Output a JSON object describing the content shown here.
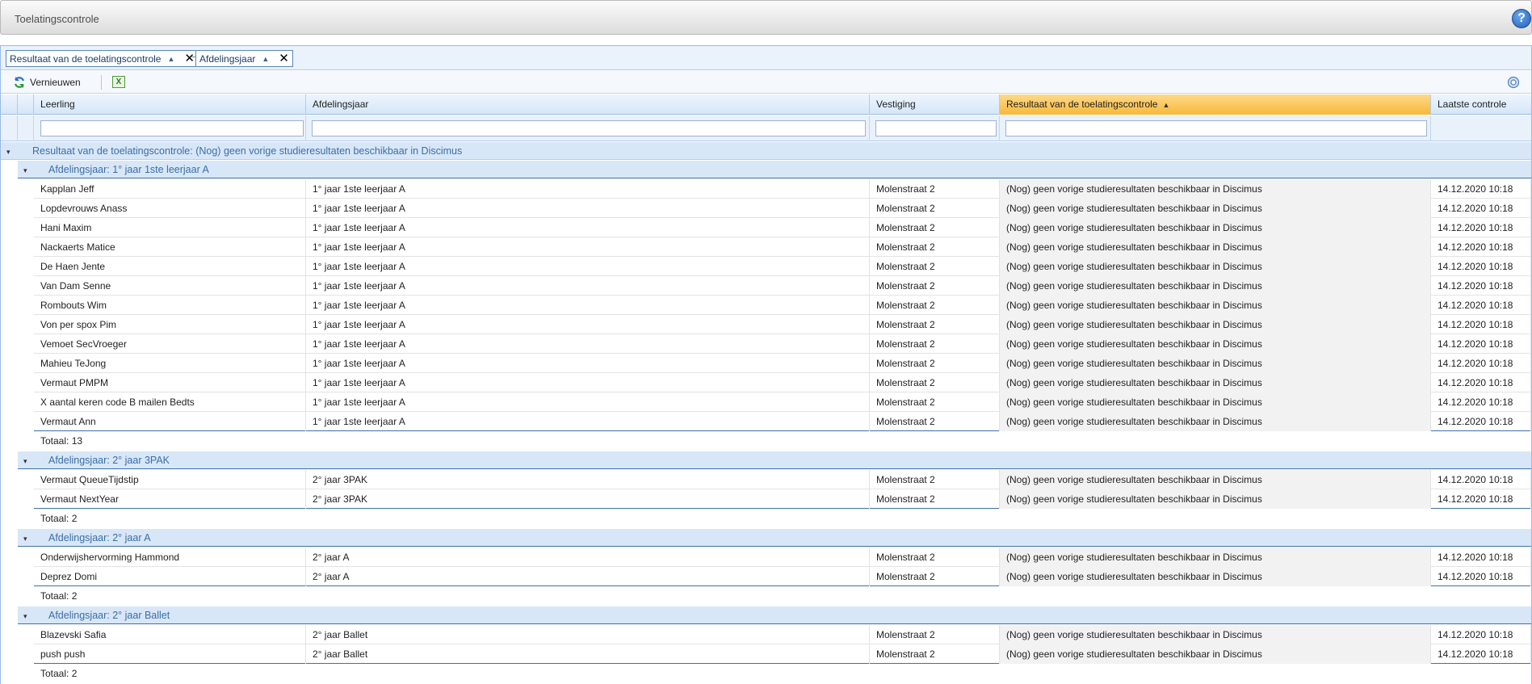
{
  "window": {
    "title": "Toelatingscontrole",
    "help": "?"
  },
  "groupbar": {
    "chips": [
      {
        "label": "Resultaat van de toelatingscontrole"
      },
      {
        "label": "Afdelingsjaar"
      }
    ]
  },
  "toolbar": {
    "refresh_label": "Vernieuwen",
    "excel_label": "X"
  },
  "columns": {
    "leerling": "Leerling",
    "afdelingsjaar": "Afdelingsjaar",
    "vestiging": "Vestiging",
    "resultaat": "Resultaat van de toelatingscontrole",
    "laatste": "Laatste controle"
  },
  "outer_group": {
    "label": "Resultaat van de toelatingscontrole: (Nog) geen vorige studieresultaten beschikbaar in Discimus"
  },
  "groups": [
    {
      "label": "Afdelingsjaar: 1° jaar 1ste leerjaar A",
      "total": "Totaal: 13",
      "rows": [
        {
          "leerling": "Kapplan Jeff",
          "afdelingsjaar": "1° jaar 1ste leerjaar A",
          "vestiging": "Molenstraat 2",
          "resultaat": "(Nog) geen vorige studieresultaten beschikbaar in Discimus",
          "laatste": "14.12.2020 10:18"
        },
        {
          "leerling": "Lopdevrouws Anass",
          "afdelingsjaar": "1° jaar 1ste leerjaar A",
          "vestiging": "Molenstraat 2",
          "resultaat": "(Nog) geen vorige studieresultaten beschikbaar in Discimus",
          "laatste": "14.12.2020 10:18"
        },
        {
          "leerling": "Hani Maxim",
          "afdelingsjaar": "1° jaar 1ste leerjaar A",
          "vestiging": "Molenstraat 2",
          "resultaat": "(Nog) geen vorige studieresultaten beschikbaar in Discimus",
          "laatste": "14.12.2020 10:18"
        },
        {
          "leerling": "Nackaerts Matice",
          "afdelingsjaar": "1° jaar 1ste leerjaar A",
          "vestiging": "Molenstraat 2",
          "resultaat": "(Nog) geen vorige studieresultaten beschikbaar in Discimus",
          "laatste": "14.12.2020 10:18"
        },
        {
          "leerling": "De Haen Jente",
          "afdelingsjaar": "1° jaar 1ste leerjaar A",
          "vestiging": "Molenstraat 2",
          "resultaat": "(Nog) geen vorige studieresultaten beschikbaar in Discimus",
          "laatste": "14.12.2020 10:18"
        },
        {
          "leerling": "Van Dam Senne",
          "afdelingsjaar": "1° jaar 1ste leerjaar A",
          "vestiging": "Molenstraat 2",
          "resultaat": "(Nog) geen vorige studieresultaten beschikbaar in Discimus",
          "laatste": "14.12.2020 10:18"
        },
        {
          "leerling": "Rombouts Wim",
          "afdelingsjaar": "1° jaar 1ste leerjaar A",
          "vestiging": "Molenstraat 2",
          "resultaat": "(Nog) geen vorige studieresultaten beschikbaar in Discimus",
          "laatste": "14.12.2020 10:18"
        },
        {
          "leerling": "Von per spox Pim",
          "afdelingsjaar": "1° jaar 1ste leerjaar A",
          "vestiging": "Molenstraat 2",
          "resultaat": "(Nog) geen vorige studieresultaten beschikbaar in Discimus",
          "laatste": "14.12.2020 10:18"
        },
        {
          "leerling": "Vemoet SecVroeger",
          "afdelingsjaar": "1° jaar 1ste leerjaar A",
          "vestiging": "Molenstraat 2",
          "resultaat": "(Nog) geen vorige studieresultaten beschikbaar in Discimus",
          "laatste": "14.12.2020 10:18"
        },
        {
          "leerling": "Mahieu TeJong",
          "afdelingsjaar": "1° jaar 1ste leerjaar A",
          "vestiging": "Molenstraat 2",
          "resultaat": "(Nog) geen vorige studieresultaten beschikbaar in Discimus",
          "laatste": "14.12.2020 10:18"
        },
        {
          "leerling": "Vermaut PMPM",
          "afdelingsjaar": "1° jaar 1ste leerjaar A",
          "vestiging": "Molenstraat 2",
          "resultaat": "(Nog) geen vorige studieresultaten beschikbaar in Discimus",
          "laatste": "14.12.2020 10:18"
        },
        {
          "leerling": "X aantal keren code B mailen Bedts",
          "afdelingsjaar": "1° jaar 1ste leerjaar A",
          "vestiging": "Molenstraat 2",
          "resultaat": "(Nog) geen vorige studieresultaten beschikbaar in Discimus",
          "laatste": "14.12.2020 10:18"
        },
        {
          "leerling": "Vermaut Ann",
          "afdelingsjaar": "1° jaar 1ste leerjaar A",
          "vestiging": "Molenstraat 2",
          "resultaat": "(Nog) geen vorige studieresultaten beschikbaar in Discimus",
          "laatste": "14.12.2020 10:18"
        }
      ]
    },
    {
      "label": "Afdelingsjaar: 2° jaar 3PAK",
      "total": "Totaal: 2",
      "rows": [
        {
          "leerling": "Vermaut QueueTijdstip",
          "afdelingsjaar": "2° jaar 3PAK",
          "vestiging": "Molenstraat 2",
          "resultaat": "(Nog) geen vorige studieresultaten beschikbaar in Discimus",
          "laatste": "14.12.2020 10:18"
        },
        {
          "leerling": "Vermaut NextYear",
          "afdelingsjaar": "2° jaar 3PAK",
          "vestiging": "Molenstraat 2",
          "resultaat": "(Nog) geen vorige studieresultaten beschikbaar in Discimus",
          "laatste": "14.12.2020 10:18"
        }
      ]
    },
    {
      "label": "Afdelingsjaar: 2° jaar A",
      "total": "Totaal: 2",
      "rows": [
        {
          "leerling": "Onderwijshervorming Hammond",
          "afdelingsjaar": "2° jaar A",
          "vestiging": "Molenstraat 2",
          "resultaat": "(Nog) geen vorige studieresultaten beschikbaar in Discimus",
          "laatste": "14.12.2020 10:18"
        },
        {
          "leerling": "Deprez Domi",
          "afdelingsjaar": "2° jaar A",
          "vestiging": "Molenstraat 2",
          "resultaat": "(Nog) geen vorige studieresultaten beschikbaar in Discimus",
          "laatste": "14.12.2020 10:18"
        }
      ]
    },
    {
      "label": "Afdelingsjaar: 2° jaar Ballet",
      "total": "Totaal: 2",
      "rows": [
        {
          "leerling": "Blazevski Safia",
          "afdelingsjaar": "2° jaar Ballet",
          "vestiging": "Molenstraat 2",
          "resultaat": "(Nog) geen vorige studieresultaten beschikbaar in Discimus",
          "laatste": "14.12.2020 10:18"
        },
        {
          "leerling": "push push",
          "afdelingsjaar": "2° jaar Ballet",
          "vestiging": "Molenstraat 2",
          "resultaat": "(Nog) geen vorige studieresultaten beschikbaar in Discimus",
          "laatste": "14.12.2020 10:18"
        }
      ]
    }
  ]
}
